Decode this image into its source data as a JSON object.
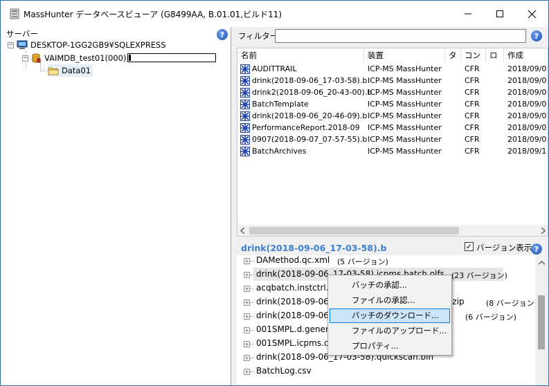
{
  "window": {
    "title": "MassHunter データベースビューア (G8499AA, B.01.01,ビルド11)"
  },
  "server_pane": {
    "header": "サーバー",
    "tree": [
      {
        "label": "DESKTOP-1GG2GB9¥SQLEXPRESS",
        "icon": "server-icon"
      },
      {
        "label": "VAIMDB_test01(000)",
        "icon": "database-icon",
        "progress": 0.02
      },
      {
        "label": "Data01",
        "icon": "folder-icon"
      }
    ]
  },
  "filter": {
    "label": "フィルター",
    "value": ""
  },
  "file_list": {
    "columns": [
      "名前",
      "装置",
      "タ",
      "コン",
      "ロ",
      "作成"
    ],
    "rows": [
      {
        "name": "AUDITTRAIL",
        "device": "ICP-MS MassHunter",
        "con": "CFR",
        "created": "2018/09/0"
      },
      {
        "name": "drink(2018-09-06_17-03-58).b",
        "device": "ICP-MS MassHunter",
        "con": "CFR",
        "created": "2018/09/0"
      },
      {
        "name": "drink2(2018-09-06_20-43-00).b",
        "device": "ICP-MS MassHunter",
        "con": "CFR",
        "created": "2018/09/0"
      },
      {
        "name": "BatchTemplate",
        "device": "ICP-MS MassHunter",
        "con": "CFR",
        "created": "2018/09/0"
      },
      {
        "name": "drink(2018-09-06_20-46-09).b",
        "device": "ICP-MS MassHunter",
        "con": "CFR",
        "created": "2018/09/0"
      },
      {
        "name": "PerformanceReport.2018-09",
        "device": "ICP-MS MassHunter",
        "con": "CFR",
        "created": "2018/09/0"
      },
      {
        "name": "0907(2018-09-07_07-57-55).b",
        "device": "ICP-MS MassHunter",
        "con": "CFR",
        "created": "2018/09/0"
      },
      {
        "name": "BatchArchives",
        "device": "ICP-MS MassHunter",
        "con": "CFR",
        "created": "2018/09/1"
      }
    ]
  },
  "detail": {
    "title": "drink(2018-09-06_17-03-58).b",
    "version_checkbox_label": "バージョン表示",
    "version_checked": true,
    "items": [
      {
        "name": "DAMethod.qc.xml",
        "versions": "(5 バージョン)"
      },
      {
        "name": "drink(2018-09-06_17-03-58).icpms.batch.olfs",
        "versions": "(23 バージョン)"
      },
      {
        "name": "acqbatch.instctrl.a",
        "versions": ""
      },
      {
        "name": "drink(2018-09-06_",
        "suffix": "izip",
        "versions": "(8 バージョン)"
      },
      {
        "name": "drink(2018-09-06_",
        "versions": "(6 バージョン)"
      },
      {
        "name": "001SMPL.d.gener",
        "versions": ""
      },
      {
        "name": "001SMPL.icpms.c",
        "versions": ""
      },
      {
        "name": "drink(2018-09-06_17-03-58).quickscan.bin",
        "versions": ""
      },
      {
        "name": "BatchLog.csv",
        "versions": ""
      }
    ]
  },
  "context_menu": {
    "items": [
      "バッチの承認...",
      "ファイルの承認...",
      "バッチのダウンロード...",
      "ファイルのアップロード...",
      "プロパティ..."
    ],
    "hovered_index": 2
  },
  "colors": {
    "accent": "#3c7fd0",
    "menu_hover": "#cce4f7",
    "menu_hover_border": "#0078d7"
  }
}
